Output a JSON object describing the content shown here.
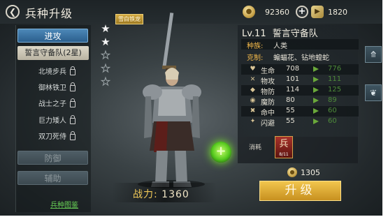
{
  "header": {
    "back_icon": "chevron-left-icon",
    "title": "兵种升级"
  },
  "resources": {
    "coins": "92360",
    "tokens": "1820"
  },
  "sidebar": {
    "attack_tab": "进攻",
    "selected_unit": "誓言守备队(2星)",
    "units": [
      "北境步兵",
      "御林铁卫",
      "战士之子",
      "巨力矮人",
      "双刀死侍"
    ],
    "defense_tab": "防御",
    "support_tab": "辅助",
    "guide_link": "兵种图鉴"
  },
  "stars": {
    "filled": 2,
    "total": 5
  },
  "equip_badge": "雪白铁龙",
  "hero": {
    "power_label": "战力:",
    "power_value": "1360"
  },
  "info": {
    "level": "Lv.11",
    "unit_name": "誓言守备队",
    "race_label": "种族:",
    "race_value": "人类",
    "counter_label": "克制:",
    "counter_value": "蝙蝠花、钻地蝗蛇"
  },
  "stats": [
    {
      "icon": "heart-icon",
      "name": "生命",
      "value": "708",
      "next": "776"
    },
    {
      "icon": "crossed-swords-icon",
      "name": "物攻",
      "value": "101",
      "next": "111"
    },
    {
      "icon": "shield-icon",
      "name": "物防",
      "value": "114",
      "next": "125"
    },
    {
      "icon": "magic-shield-icon",
      "name": "魔防",
      "value": "80",
      "next": "89"
    },
    {
      "icon": "target-icon",
      "name": "命中",
      "value": "55",
      "next": "60"
    },
    {
      "icon": "dodge-icon",
      "name": "闪避",
      "value": "55",
      "next": "60"
    }
  ],
  "cost": {
    "label": "消耗",
    "card_char": "兵",
    "card_count": "8/11",
    "gold": "1305"
  },
  "upgrade_button": "升级",
  "colors": {
    "accent_gold": "#e9b43a",
    "tab_blue": "#3a72a6",
    "next_value_green": "#4e8b3a",
    "key_orange": "#f2b84a"
  }
}
